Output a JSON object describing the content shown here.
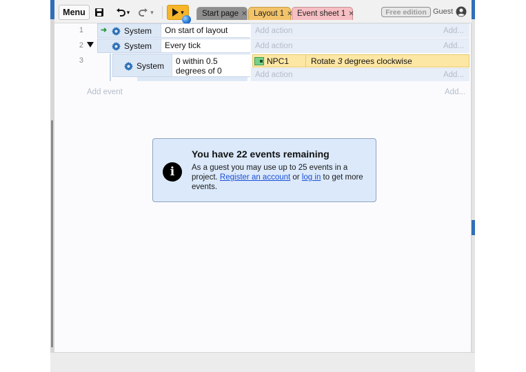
{
  "toolbar": {
    "menu_label": "Menu",
    "save_icon": "save-icon",
    "undo_icon": "undo-icon",
    "redo_icon": "redo-icon",
    "play_icon": "play-icon",
    "dropdown_glyph": "▾"
  },
  "tabs": [
    {
      "label": "Start page",
      "close": "✕"
    },
    {
      "label": "Layout 1",
      "close": "✕"
    },
    {
      "label": "Event sheet 1",
      "close": "✕"
    }
  ],
  "account": {
    "badge": "Free edition",
    "guest_label": "Guest"
  },
  "events": [
    {
      "number": "1",
      "object": "System",
      "condition": "On start of layout",
      "add_action": "Add action",
      "add_right": "Add..."
    },
    {
      "number": "2",
      "object": "System",
      "condition": "Every tick",
      "add_action": "Add action",
      "add_right": "Add..."
    },
    {
      "number": "3",
      "object": "System",
      "condition_line1": "0 within 0.5",
      "condition_line2": "degrees of 0",
      "action_object": "NPC1",
      "action_prefix": "Rotate ",
      "action_value": "3",
      "action_suffix": " degrees clockwise",
      "add_action": "Add action",
      "add_right": "Add..."
    }
  ],
  "add_event": {
    "label": "Add event",
    "add_right": "Add..."
  },
  "notice": {
    "icon": "info-icon",
    "title": "You have 22 events remaining",
    "body_1": "As a guest you may use up to 25 events in a project. ",
    "link_register": "Register an account",
    "body_2": " or ",
    "link_login": "log in",
    "body_3": " to get more events."
  },
  "colors": {
    "play_button": "#f7b52a",
    "event_sheet_tab": "#f6bfc3",
    "layout_tab": "#f3c36a",
    "action_highlight": "#fde7a4",
    "notice_background": "#dbe9fb",
    "link": "#1a4fd6"
  }
}
